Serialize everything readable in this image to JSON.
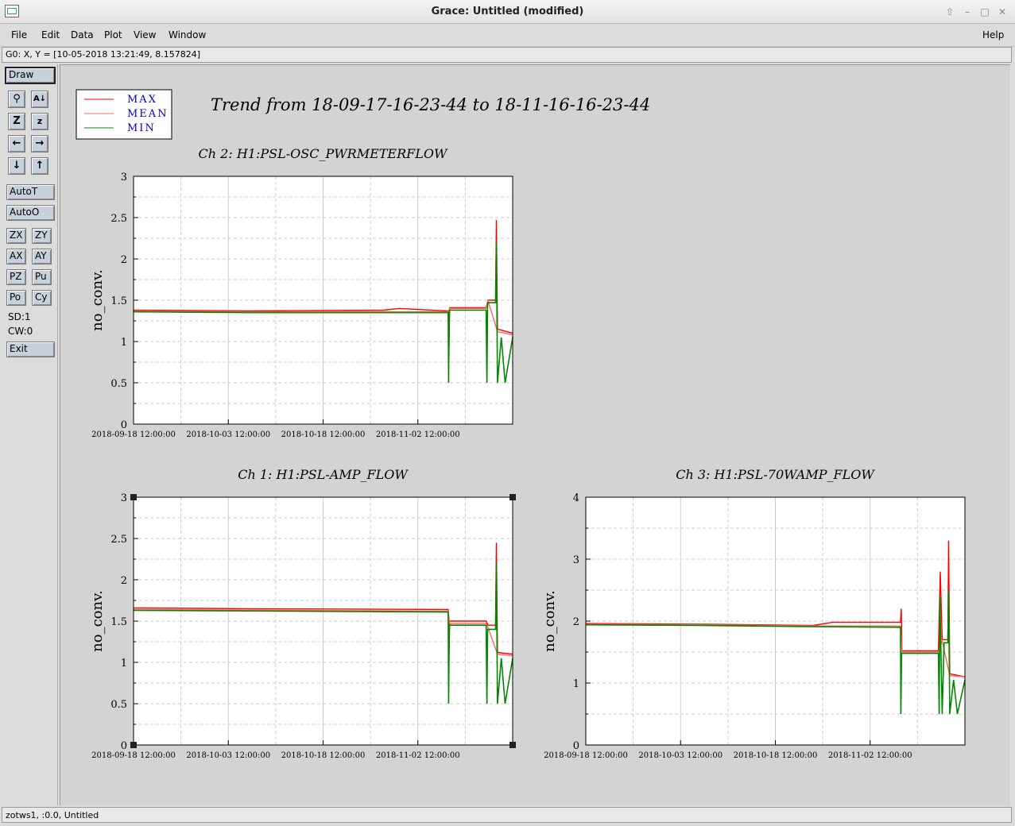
{
  "window": {
    "title": "Grace: Untitled (modified)"
  },
  "menu": [
    {
      "label": "File",
      "u": "F"
    },
    {
      "label": "Edit",
      "u": "E"
    },
    {
      "label": "Data",
      "u": "D"
    },
    {
      "label": "Plot",
      "u": "P"
    },
    {
      "label": "View",
      "u": "V"
    },
    {
      "label": "Window",
      "u": "W"
    }
  ],
  "help_label": "Help",
  "locator_text": "G0: X, Y = [10-05-2018 13:21:49, 8.157824]",
  "toolbar": {
    "draw": "Draw",
    "autot": "AutoT",
    "autoo": "AutoO",
    "zx": "ZX",
    "zy": "ZY",
    "ax": "AX",
    "ay": "AY",
    "pz": "PZ",
    "pu": "Pu",
    "po": "Po",
    "cy": "Cy",
    "sd": "SD:1",
    "cw": "CW:0",
    "exit": "Exit"
  },
  "status_text": "zotws1, :0.0, Untitled",
  "canvas": {
    "page_title": "Trend from 18-09-17-16-23-44 to 18-11-16-16-23-44",
    "legend": [
      {
        "label": "MAX",
        "color": "#ff0000"
      },
      {
        "label": "MEAN",
        "color": "#ff6666"
      },
      {
        "label": "MIN",
        "color": "#008800"
      }
    ]
  },
  "chart_data": [
    {
      "type": "line",
      "title": "Ch 2: H1:PSL-OSC_PWRMETERFLOW",
      "ylabel": "no_conv.",
      "ylim": [
        0,
        3
      ],
      "yticks": [
        "0",
        "0.5",
        "1",
        "1.5",
        "2",
        "2.5",
        "3"
      ],
      "xticks": [
        "2018-09-18 12:00:00",
        "2018-10-03 12:00:00",
        "2018-10-18 12:00:00",
        "2018-11-02 12:00:00"
      ],
      "grid": true,
      "series": [
        {
          "name": "MAX",
          "color": "#ff0000",
          "points": [
            [
              0,
              1.38
            ],
            [
              0.3,
              1.37
            ],
            [
              0.66,
              1.38
            ],
            [
              0.7,
              1.4
            ],
            [
              0.83,
              1.37
            ],
            [
              0.832,
              0.95
            ],
            [
              0.834,
              1.41
            ],
            [
              0.93,
              1.41
            ],
            [
              0.935,
              1.5
            ],
            [
              0.955,
              1.5
            ],
            [
              0.957,
              2.47
            ],
            [
              0.96,
              1.15
            ],
            [
              1,
              1.1
            ]
          ]
        },
        {
          "name": "MEAN",
          "color": "#ff6666",
          "points": [
            [
              0,
              1.37
            ],
            [
              0.3,
              1.36
            ],
            [
              0.83,
              1.36
            ],
            [
              0.834,
              1.4
            ],
            [
              0.93,
              1.4
            ],
            [
              0.935,
              1.49
            ],
            [
              0.96,
              1.12
            ],
            [
              1,
              1.08
            ]
          ]
        },
        {
          "name": "MIN",
          "color": "#008800",
          "points": [
            [
              0,
              1.36
            ],
            [
              0.3,
              1.35
            ],
            [
              0.83,
              1.35
            ],
            [
              0.831,
              0.5
            ],
            [
              0.833,
              1.38
            ],
            [
              0.93,
              1.38
            ],
            [
              0.932,
              0.5
            ],
            [
              0.934,
              1.47
            ],
            [
              0.955,
              1.47
            ],
            [
              0.957,
              2.2
            ],
            [
              0.96,
              0.5
            ],
            [
              0.97,
              1.05
            ],
            [
              0.98,
              0.5
            ],
            [
              1,
              1.05
            ]
          ]
        }
      ]
    },
    {
      "type": "line",
      "title": "Ch 1: H1:PSL-AMP_FLOW",
      "ylabel": "no_conv.",
      "ylim": [
        0,
        3
      ],
      "yticks": [
        "0",
        "0.5",
        "1",
        "1.5",
        "2",
        "2.5",
        "3"
      ],
      "xticks": [
        "2018-09-18 12:00:00",
        "2018-10-03 12:00:00",
        "2018-10-18 12:00:00",
        "2018-11-02 12:00:00"
      ],
      "grid": true,
      "series": [
        {
          "name": "MAX",
          "color": "#ff0000",
          "points": [
            [
              0,
              1.66
            ],
            [
              0.3,
              1.65
            ],
            [
              0.83,
              1.64
            ],
            [
              0.832,
              1.1
            ],
            [
              0.834,
              1.5
            ],
            [
              0.93,
              1.5
            ],
            [
              0.935,
              1.45
            ],
            [
              0.955,
              1.45
            ],
            [
              0.957,
              2.45
            ],
            [
              0.96,
              1.12
            ],
            [
              1,
              1.1
            ]
          ]
        },
        {
          "name": "MEAN",
          "color": "#ff6666",
          "points": [
            [
              0,
              1.64
            ],
            [
              0.83,
              1.62
            ],
            [
              0.834,
              1.47
            ],
            [
              0.93,
              1.47
            ],
            [
              0.935,
              1.42
            ],
            [
              0.96,
              1.1
            ],
            [
              1,
              1.08
            ]
          ]
        },
        {
          "name": "MIN",
          "color": "#008800",
          "points": [
            [
              0,
              1.63
            ],
            [
              0.83,
              1.61
            ],
            [
              0.831,
              0.5
            ],
            [
              0.833,
              1.45
            ],
            [
              0.93,
              1.45
            ],
            [
              0.932,
              0.5
            ],
            [
              0.934,
              1.4
            ],
            [
              0.955,
              1.4
            ],
            [
              0.957,
              2.2
            ],
            [
              0.96,
              0.5
            ],
            [
              0.97,
              1.05
            ],
            [
              0.98,
              0.5
            ],
            [
              1,
              1.05
            ]
          ]
        }
      ]
    },
    {
      "type": "line",
      "title": "Ch 3: H1:PSL-70WAMP_FLOW",
      "ylabel": "no_conv.",
      "ylim": [
        0,
        4
      ],
      "yticks": [
        "0",
        "1",
        "2",
        "3",
        "4"
      ],
      "xticks": [
        "2018-09-18 12:00:00",
        "2018-10-03 12:00:00",
        "2018-10-18 12:00:00",
        "2018-11-02 12:00:00"
      ],
      "grid": true,
      "series": [
        {
          "name": "MAX",
          "color": "#ff0000",
          "points": [
            [
              0,
              1.96
            ],
            [
              0.3,
              1.95
            ],
            [
              0.6,
              1.93
            ],
            [
              0.65,
              1.98
            ],
            [
              0.83,
              1.98
            ],
            [
              0.832,
              2.2
            ],
            [
              0.834,
              1.52
            ],
            [
              0.93,
              1.52
            ],
            [
              0.935,
              2.8
            ],
            [
              0.94,
              1.7
            ],
            [
              0.955,
              1.7
            ],
            [
              0.957,
              3.3
            ],
            [
              0.96,
              1.15
            ],
            [
              1,
              1.1
            ]
          ]
        },
        {
          "name": "MEAN",
          "color": "#ff6666",
          "points": [
            [
              0,
              1.95
            ],
            [
              0.3,
              1.94
            ],
            [
              0.6,
              1.92
            ],
            [
              0.83,
              1.92
            ],
            [
              0.834,
              1.5
            ],
            [
              0.93,
              1.5
            ],
            [
              0.94,
              1.68
            ],
            [
              0.96,
              1.12
            ],
            [
              1,
              1.1
            ]
          ]
        },
        {
          "name": "MIN",
          "color": "#008800",
          "points": [
            [
              0,
              1.94
            ],
            [
              0.3,
              1.93
            ],
            [
              0.6,
              1.91
            ],
            [
              0.83,
              1.9
            ],
            [
              0.831,
              0.5
            ],
            [
              0.833,
              1.48
            ],
            [
              0.93,
              1.48
            ],
            [
              0.932,
              0.5
            ],
            [
              0.934,
              2.4
            ],
            [
              0.94,
              0.5
            ],
            [
              0.945,
              1.65
            ],
            [
              0.955,
              1.65
            ],
            [
              0.957,
              2.5
            ],
            [
              0.96,
              0.5
            ],
            [
              0.97,
              1.05
            ],
            [
              0.98,
              0.5
            ],
            [
              1,
              1.05
            ]
          ]
        }
      ]
    }
  ]
}
